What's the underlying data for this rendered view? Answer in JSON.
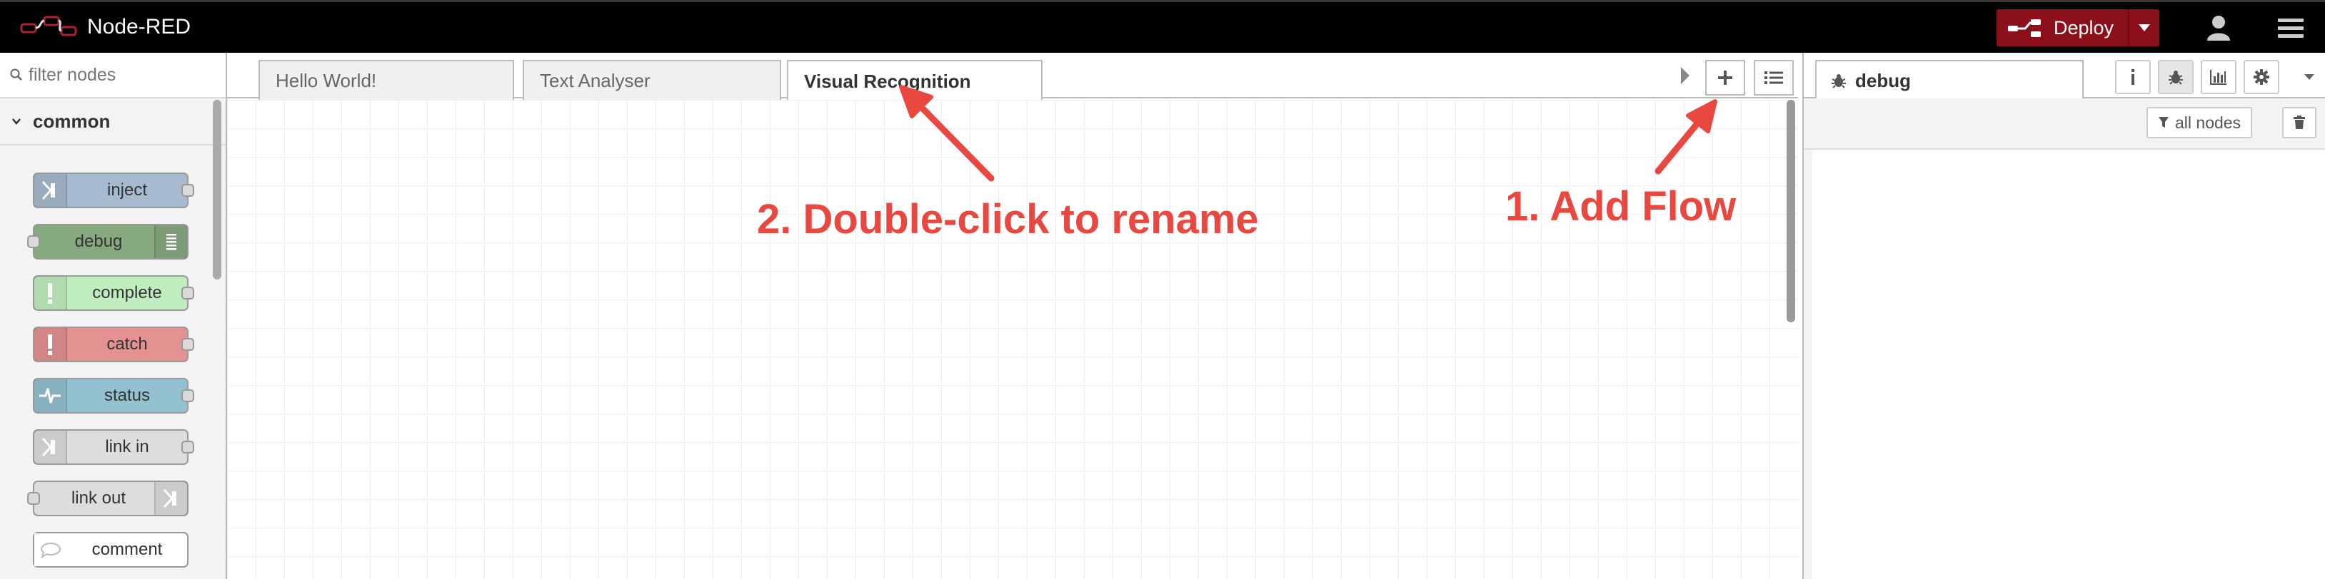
{
  "header": {
    "title": "Node-RED",
    "logo_icon": "node-red-logo-icon",
    "deploy_label": "Deploy",
    "colors": {
      "background": "#000000",
      "deploy": "#8c101c"
    }
  },
  "palette": {
    "search_placeholder": "filter nodes",
    "category": "common",
    "nodes": [
      {
        "label": "inject",
        "color": "#a6bbcf",
        "icon": "inject-arrow-icon"
      },
      {
        "label": "debug",
        "color": "#87a980",
        "icon": "debug-list-icon"
      },
      {
        "label": "complete",
        "color": "#c0edc0",
        "icon": "exclamation-icon"
      },
      {
        "label": "catch",
        "color": "#e49191",
        "icon": "exclamation-icon"
      },
      {
        "label": "status",
        "color": "#94c1d0",
        "icon": "pulse-icon"
      },
      {
        "label": "link in",
        "color": "#dddddd",
        "icon": "link-in-icon"
      },
      {
        "label": "link out",
        "color": "#dddddd",
        "icon": "link-out-icon"
      },
      {
        "label": "comment",
        "color": "#ffffff",
        "icon": "comment-icon"
      }
    ]
  },
  "workspace": {
    "tabs": [
      {
        "label": "Hello World!",
        "active": false
      },
      {
        "label": "Text Analyser",
        "active": false
      },
      {
        "label": "Visual Recognition",
        "active": true
      }
    ]
  },
  "annotations": {
    "rename": "2. Double-click to rename",
    "add_flow": "1. Add Flow",
    "color": "#e8483f"
  },
  "sidebar": {
    "active_tab": "debug",
    "filter_label": "all nodes"
  }
}
